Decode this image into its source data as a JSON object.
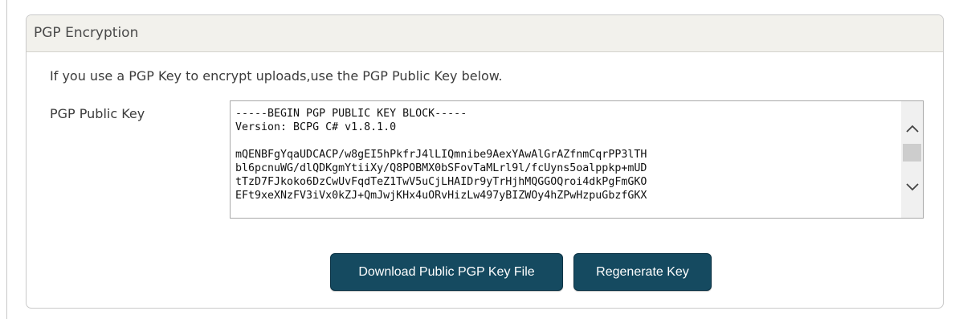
{
  "panel": {
    "title": "PGP Encryption",
    "intro": "If you use a PGP Key to encrypt uploads,use the PGP Public Key below.",
    "key_label": "PGP Public Key",
    "key_value": "-----BEGIN PGP PUBLIC KEY BLOCK-----\nVersion: BCPG C# v1.8.1.0\n\nmQENBFgYqaUDCACP/w8gEI5hPkfrJ4lLIQmnibe9AexYAwAlGrAZfnmCqrPP3lTH\nbl6pcnuWG/dlQDKgmYtiiXy/Q8POBMX0bSFovTaMLrl9l/fcUyns5oalppkp+mUD\ntTzD7FJkoko6DzCwUvFqdTeZ1TwV5uCjLHAIDr9yTrHjhMQGGOQroi4dkPgFmGKO\nEFt9xeXNzFV3iVx0kZJ+QmJwjKHx4uORvHizLw497yBIZWOy4hZPwHzpuGbzfGKX",
    "buttons": {
      "download": "Download Public PGP Key File",
      "regenerate": "Regenerate Key"
    }
  },
  "icons": {
    "scroll_up": "chevron-up-icon",
    "scroll_down": "chevron-down-icon"
  },
  "colors": {
    "button_bg": "#154a60",
    "header_bg": "#f2f1ec",
    "border": "#c9c9c9"
  }
}
